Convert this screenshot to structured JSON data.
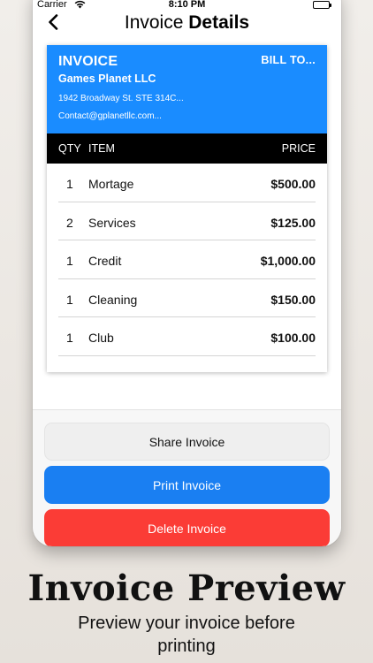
{
  "status_bar": {
    "carrier": "Carrier",
    "time": "8:10 PM"
  },
  "nav": {
    "title_light": "Invoice",
    "title_bold": "Details",
    "back_icon": "chevron-left-icon"
  },
  "invoice": {
    "heading": "INVOICE",
    "bill_to": "BILL TO...",
    "company": "Games Planet LLC",
    "address": "1942 Broadway St. STE 314C...",
    "contact": "Contact@gplanetllc.com...",
    "columns": {
      "qty": "QTY",
      "item": "ITEM",
      "price": "PRICE"
    },
    "items": [
      {
        "qty": "1",
        "item": "Mortage",
        "price": "$500.00"
      },
      {
        "qty": "2",
        "item": "Services",
        "price": "$125.00"
      },
      {
        "qty": "1",
        "item": "Credit",
        "price": "$1,000.00"
      },
      {
        "qty": "1",
        "item": "Cleaning",
        "price": "$150.00"
      },
      {
        "qty": "1",
        "item": "Club",
        "price": "$100.00"
      }
    ]
  },
  "actions": {
    "share": "Share Invoice",
    "print": "Print Invoice",
    "delete": "Delete Invoice"
  },
  "caption": {
    "title": "Invoice Preview",
    "subtitle": "Preview your invoice before printing"
  },
  "colors": {
    "accent": "#1a8cff",
    "print": "#1a7ff2",
    "delete": "#fb3c36",
    "header": "#000000"
  }
}
